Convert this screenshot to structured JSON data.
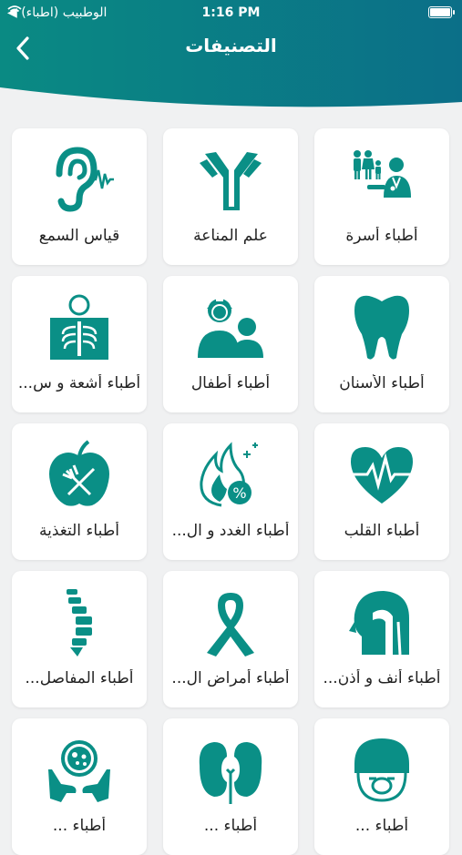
{
  "status_bar": {
    "carrier": "◀ الوطبيب (اطباء)",
    "time": "1:16 PM"
  },
  "header": {
    "title": "التصنيفات",
    "gradient_from": "#0a8a83",
    "gradient_to": "#0b6f88"
  },
  "accent_color": "#0a8f86",
  "categories": [
    {
      "label": "أطباء أسرة",
      "icon": "family-doctor-icon"
    },
    {
      "label": "علم المناعة",
      "icon": "antibody-icon"
    },
    {
      "label": "قياس السمع",
      "icon": "ear-hearing-icon"
    },
    {
      "label": "أطباء الأسنان",
      "icon": "tooth-icon"
    },
    {
      "label": "أطباء أطفال",
      "icon": "pediatrics-icon"
    },
    {
      "label": "أطباء أشعة و س...",
      "icon": "xray-icon"
    },
    {
      "label": "أطباء القلب",
      "icon": "heart-pulse-icon"
    },
    {
      "label": "أطباء الغدد و ال...",
      "icon": "endocrine-flame-icon"
    },
    {
      "label": "أطباء التغذية",
      "icon": "apple-nutrition-icon"
    },
    {
      "label": "أطباء أنف و أذن...",
      "icon": "ent-head-icon"
    },
    {
      "label": "أطباء أمراض ال...",
      "icon": "ribbon-icon"
    },
    {
      "label": "أطباء المفاصل...",
      "icon": "spine-icon"
    },
    {
      "label": "أطباء ...",
      "icon": "anesthesia-mask-icon"
    },
    {
      "label": "أطباء ...",
      "icon": "kidneys-icon"
    },
    {
      "label": "أطباء ...",
      "icon": "petri-hands-icon"
    }
  ]
}
